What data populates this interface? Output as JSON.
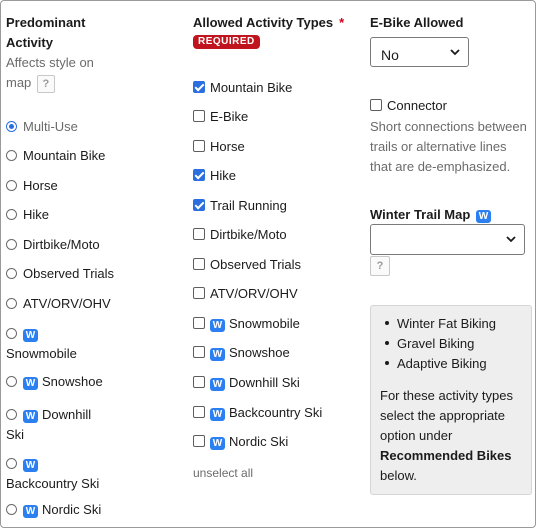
{
  "predominant": {
    "heading_line1": "Predominant",
    "heading_line2": "Activity",
    "help_line1": "Affects style on",
    "help_line2": "map",
    "help_icon": "?",
    "options": [
      {
        "label": "Multi-Use",
        "checked": true
      },
      {
        "label": "Mountain Bike"
      },
      {
        "label": "Horse"
      },
      {
        "label": "Hike"
      },
      {
        "label": "Dirtbike/Moto"
      },
      {
        "label": "Observed Trials"
      },
      {
        "label": "ATV/ORV/OHV"
      },
      {
        "label": "Snowmobile",
        "badge": "W"
      },
      {
        "label": "Snowshoe",
        "badge": "W"
      },
      {
        "label_line1": "Downhill",
        "label_line2": "Ski",
        "badge": "W"
      },
      {
        "label": "Backcountry Ski",
        "badge": "W"
      },
      {
        "label": "Nordic Ski",
        "badge": "W"
      }
    ]
  },
  "allowed": {
    "heading": "Allowed Activity Types",
    "required_star": "*",
    "required_badge": "REQUIRED",
    "options": [
      {
        "label": "Mountain Bike",
        "checked": true
      },
      {
        "label": "E-Bike"
      },
      {
        "label": "Horse"
      },
      {
        "label": "Hike",
        "checked": true
      },
      {
        "label": "Trail Running",
        "checked": true
      },
      {
        "label": "Dirtbike/Moto"
      },
      {
        "label": "Observed Trials"
      },
      {
        "label": "ATV/ORV/OHV"
      },
      {
        "label": "Snowmobile",
        "badge": "W"
      },
      {
        "label": "Snowshoe",
        "badge": "W"
      },
      {
        "label": "Downhill Ski",
        "badge": "W"
      },
      {
        "label": "Backcountry Ski",
        "badge": "W"
      },
      {
        "label": "Nordic Ski",
        "badge": "W"
      }
    ],
    "unselect_all": "unselect all"
  },
  "ebike": {
    "heading": "E-Bike Allowed",
    "selected": "No",
    "connector_label": "Connector",
    "connector_help_line1": "Short connections between",
    "connector_help_line2": "trails or alternative lines",
    "connector_help_line3": "that are de-emphasized."
  },
  "winter": {
    "heading": "Winter Trail Map",
    "badge": "W",
    "selected": "",
    "help_icon": "?"
  },
  "info": {
    "items": [
      "Winter Fat Biking",
      "Gravel Biking",
      "Adaptive Biking"
    ],
    "para_line1": "For these activity types",
    "para_line2": "select the appropriate",
    "para_line3": "option under",
    "para_bold": "Recommended Bikes",
    "para_end": "below."
  },
  "colors": {
    "accent": "#2a6ee0",
    "badge_blue": "#2b7ff0",
    "required_red": "#c0141f"
  }
}
